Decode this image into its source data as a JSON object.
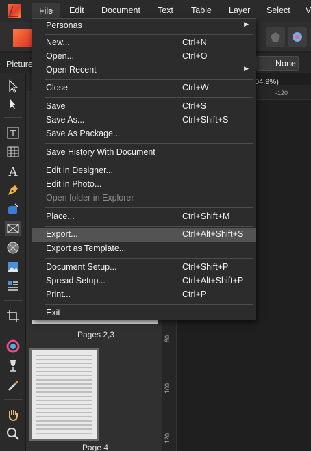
{
  "menubar": {
    "items": [
      "File",
      "Edit",
      "Document",
      "Text",
      "Table",
      "Layer",
      "Select",
      "V"
    ],
    "active": "File"
  },
  "context": {
    "label": "Picture",
    "none_value": "None",
    "zoom_fragment": "04.9%)"
  },
  "ruler": {
    "h_tick": "-120",
    "v_ticks": [
      "80",
      "100",
      "120"
    ]
  },
  "pages_panel": {
    "pages_2_3": "Pages 2,3",
    "page_4": "Page 4"
  },
  "file_menu": {
    "items": [
      {
        "label": "Personas",
        "shortcut": "",
        "submenu": true
      },
      {
        "label": "New...",
        "shortcut": "Ctrl+N"
      },
      {
        "label": "Open...",
        "shortcut": "Ctrl+O"
      },
      {
        "label": "Open Recent",
        "shortcut": "",
        "submenu": true
      },
      {
        "label": "Close",
        "shortcut": "Ctrl+W"
      },
      {
        "label": "Save",
        "shortcut": "Ctrl+S"
      },
      {
        "label": "Save As...",
        "shortcut": "Ctrl+Shift+S"
      },
      {
        "label": "Save As Package...",
        "shortcut": ""
      },
      {
        "label": "Save History With Document",
        "shortcut": ""
      },
      {
        "label": "Edit in Designer...",
        "shortcut": ""
      },
      {
        "label": "Edit in Photo...",
        "shortcut": ""
      },
      {
        "label": "Open folder in Explorer",
        "shortcut": "",
        "disabled": true
      },
      {
        "label": "Place...",
        "shortcut": "Ctrl+Shift+M"
      },
      {
        "label": "Export...",
        "shortcut": "Ctrl+Alt+Shift+S",
        "highlighted": true
      },
      {
        "label": "Export as Template...",
        "shortcut": ""
      },
      {
        "label": "Document Setup...",
        "shortcut": "Ctrl+Shift+P"
      },
      {
        "label": "Spread Setup...",
        "shortcut": "Ctrl+Alt+Shift+P"
      },
      {
        "label": "Print...",
        "shortcut": "Ctrl+P"
      },
      {
        "label": "Exit",
        "shortcut": ""
      }
    ],
    "submenu_arrow": "▶"
  },
  "colors": {
    "menu_bg": "#2c2c2c",
    "highlight": "#535353",
    "brand_orange": "#e8462c"
  }
}
